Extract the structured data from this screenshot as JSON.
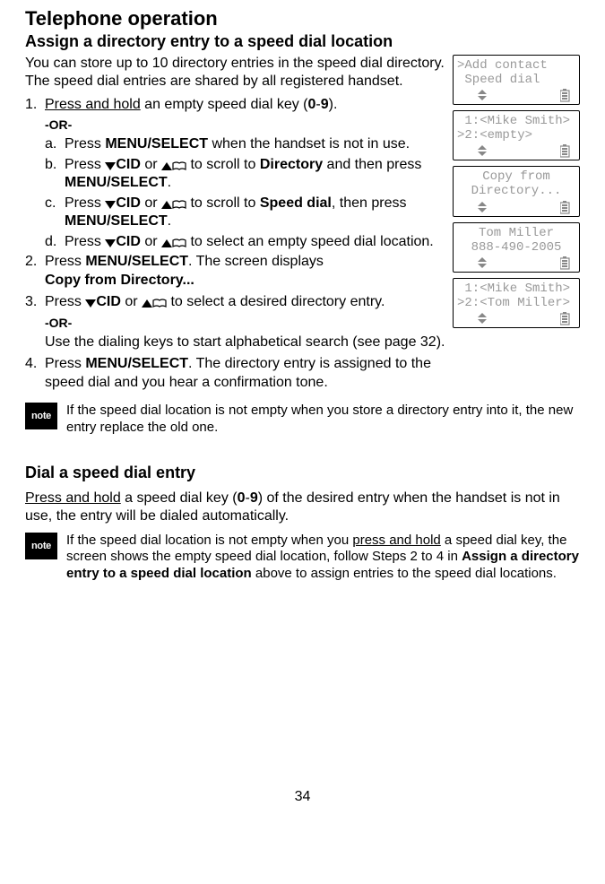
{
  "page": {
    "title": "Telephone operation",
    "number": "34"
  },
  "section1": {
    "heading": "Assign a directory entry to a speed dial location",
    "intro": "You can store up to 10 directory entries in the speed dial directory. The speed dial entries are shared by all registered handset.",
    "step1_pre": "Press and hold",
    "step1_rest": " an empty speed dial key (",
    "step1_zero": "0",
    "step1_dash": "-",
    "step1_nine": "9",
    "step1_close": ").",
    "or": "-OR-",
    "a_pre": "Press ",
    "a_menu": "MENU/SELECT",
    "a_rest": " when the handset is not in use.",
    "b_pre": "Press ",
    "b_cid": "CID",
    "b_or": " or ",
    "b_mid": " to scroll to ",
    "b_dir": "Directory",
    "b_then": " and then press ",
    "b_menu": "MENU/SELECT",
    "b_end": ".",
    "c_pre": "Press ",
    "c_cid": "CID",
    "c_or": " or ",
    "c_mid": " to scroll to ",
    "c_sd": "Speed dial",
    "c_then": ", then press ",
    "c_menu": "MENU/SELECT",
    "c_end": ".",
    "d_pre": "Press ",
    "d_cid": "CID",
    "d_or": " or ",
    "d_rest": " to select an empty speed dial location.",
    "step2_pre": "Press ",
    "step2_menu": "MENU/SELECT",
    "step2_rest": ". The screen displays ",
    "step2_copy": "Copy from Directory...",
    "step3_pre": "Press ",
    "step3_cid": "CID",
    "step3_or": " or ",
    "step3_rest": " to select a desired directory entry.",
    "step3_use": "Use the dialing keys to start alphabetical search (see page 32).",
    "step4_pre": "Press ",
    "step4_menu": "MENU/SELECT",
    "step4_rest": ". The directory entry is assigned to the speed dial and you hear a confirmation tone."
  },
  "lcd": {
    "s1l1": ">Add contact",
    "s1l2": " Speed dial",
    "s2l1": " 1:<Mike Smith>",
    "s2l2": ">2:<empty>",
    "s3l1": "Copy from",
    "s3l2": "Directory...",
    "s4l1": "Tom Miller",
    "s4l2": "888-490-2005",
    "s5l1": " 1:<Mike Smith>",
    "s5l2": ">2:<Tom Miller>"
  },
  "note1": {
    "label": "note",
    "text": "If the speed dial location is not empty when you store a directory entry into it, the new entry replace the old one."
  },
  "section2": {
    "heading": "Dial a speed dial entry",
    "p_pre": "Press and hold",
    "p_mid": " a speed dial key (",
    "p_zero": "0",
    "p_dash": "-",
    "p_nine": "9",
    "p_rest": ") of the desired entry when the handset is not in use, the entry will be dialed automatically."
  },
  "note2": {
    "label": "note",
    "t_pre": "If the speed dial location is not empty when you ",
    "t_ph": "press and hold",
    "t_mid": " a speed dial key, the screen shows the empty speed dial location, follow Steps 2 to 4 in ",
    "t_bold": "Assign a directory entry to a speed dial location",
    "t_end": " above to assign entries to the speed dial locations."
  }
}
